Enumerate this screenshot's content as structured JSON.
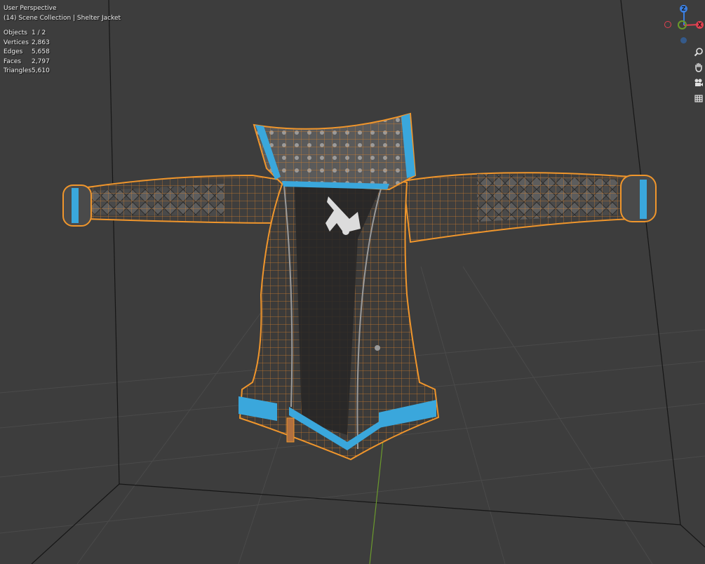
{
  "viewport": {
    "view_name": "User Perspective",
    "collection_line": "(14) Scene Collection | Shelter Jacket"
  },
  "stats": [
    {
      "label": "Objects",
      "value": "1 / 2"
    },
    {
      "label": "Vertices",
      "value": "2,863"
    },
    {
      "label": "Edges",
      "value": "5,658"
    },
    {
      "label": "Faces",
      "value": "2,797"
    },
    {
      "label": "Triangles",
      "value": "5,610"
    }
  ],
  "gizmo": {
    "z_label": "Z",
    "x_label": "X",
    "x_color": "#e04050",
    "y_color": "#6a9a2a",
    "z_color": "#3b7fe0"
  },
  "nav_tools": [
    "zoom-icon",
    "hand-pan-icon",
    "camera-icon",
    "grid-ortho-icon"
  ],
  "colors": {
    "background": "#3d3d3d",
    "selection_outline": "#f0962c",
    "jacket_trim": "#3aa7dc",
    "jacket_leather": "#3c3b3a"
  }
}
